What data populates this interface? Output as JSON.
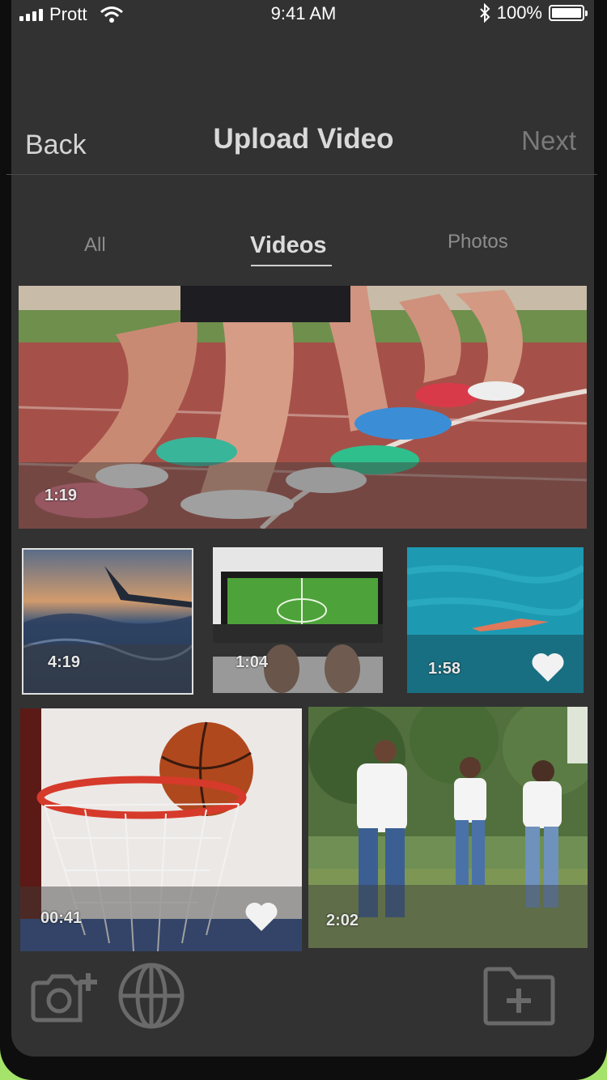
{
  "status_bar": {
    "carrier": "Prott",
    "time": "9:41 AM",
    "battery": "100%"
  },
  "nav": {
    "back_label": "Back",
    "title": "Upload Video",
    "next_label": "Next"
  },
  "tabs": [
    {
      "label": "All",
      "selected": false
    },
    {
      "label": "Videos",
      "selected": true
    },
    {
      "label": "Photos",
      "selected": false
    }
  ],
  "media": [
    {
      "duration": "1:19",
      "favorite": false,
      "subject": "runners-on-track"
    },
    {
      "duration": "4:19",
      "favorite": false,
      "subject": "airplane-wing-sunset"
    },
    {
      "duration": "1:04",
      "favorite": false,
      "subject": "soccer-game-on-phone"
    },
    {
      "duration": "1:58",
      "favorite": true,
      "subject": "swimmer-in-pool"
    },
    {
      "duration": "00:41",
      "favorite": true,
      "subject": "basketball-hoop"
    },
    {
      "duration": "2:02",
      "favorite": false,
      "subject": "family-in-park"
    }
  ],
  "toolbar": {
    "icons": [
      "camera-add-icon",
      "globe-icon",
      "folder-add-icon"
    ]
  },
  "colors": {
    "background": "#323232",
    "accent_green": "#a6e36a",
    "text_primary": "#d9d9d9",
    "text_disabled": "#7a7a7a"
  }
}
